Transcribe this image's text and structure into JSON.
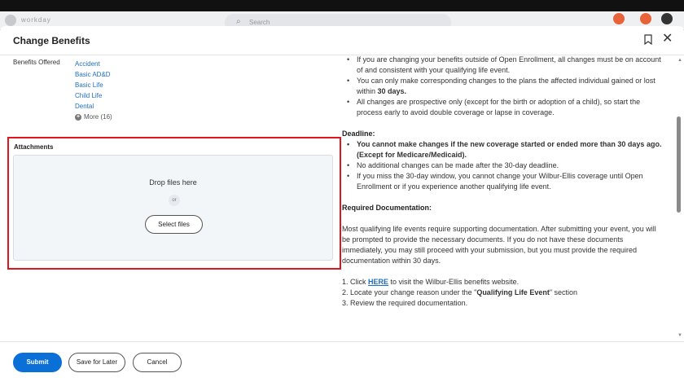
{
  "background": {
    "brand": "workday",
    "search_placeholder": "Search"
  },
  "modal": {
    "title": "Change Benefits"
  },
  "benefits": {
    "label": "Benefits Offered",
    "items": [
      "Accident",
      "Basic AD&D",
      "Basic Life",
      "Child Life",
      "Dental"
    ],
    "more": "More (16)"
  },
  "attachments": {
    "label": "Attachments",
    "drop_text": "Drop files here",
    "or_text": "or",
    "select_label": "Select files"
  },
  "info": {
    "top_bullets": [
      "If you are changing your benefits outside of Open Enrollment, all changes must be on account of and consistent with your qualifying life event.",
      "You can only make corresponding changes to the plans the affected individual gained or lost within ",
      "All changes are prospective only (except for the birth or adoption of a child), so start the process early to avoid double coverage or lapse in coverage."
    ],
    "bullet2_bold": "30 days.",
    "deadline_title": "Deadline:",
    "deadline_bullets": [
      "You cannot make changes if the new coverage started or ended more than 30 days ago. (Except for Medicare/Medicaid).",
      "No additional changes can be made after the 30-day deadline.",
      "If you miss the 30-day window, you cannot change your Wilbur-Ellis coverage until Open Enrollment or if you experience another qualifying life event."
    ],
    "docs_title": "Required Documentation:",
    "docs_paragraph": "Most qualifying life events require supporting documentation. After submitting your event, you will be prompted to provide the necessary documents. If you do not have these documents immediately, you may still proceed with your submission, but you must provide the required documentation within 30 days.",
    "step1_prefix": "1. Click ",
    "step1_link": "HERE",
    "step1_suffix": " to visit the Wilbur-Ellis benefits website.",
    "step2_prefix": "2. Locate your change reason under the \"",
    "step2_bold": "Qualifying Life Event",
    "step2_suffix": "\" section",
    "step3": "3. Review the required documentation."
  },
  "footer": {
    "submit": "Submit",
    "save_later": "Save for Later",
    "cancel": "Cancel"
  },
  "colors": {
    "accent": "#0b6fd8",
    "link": "#1f6ebf",
    "highlight": "#e0161f"
  }
}
